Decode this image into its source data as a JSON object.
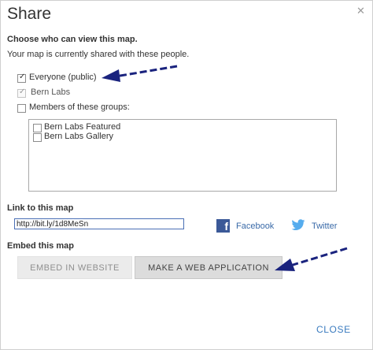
{
  "dialog": {
    "title": "Share",
    "close_link": "CLOSE"
  },
  "visibility": {
    "heading": "Choose who can view this map.",
    "description": "Your map is currently shared with these people.",
    "everyone_label": "Everyone (public)",
    "everyone_checked": true,
    "org_label": "Bern Labs",
    "org_checked": true,
    "groups_label": "Members of these groups:",
    "groups_checked": false,
    "groups": [
      {
        "label": "Bern Labs Featured",
        "checked": false
      },
      {
        "label": "Bern Labs Gallery",
        "checked": false
      }
    ]
  },
  "link": {
    "heading": "Link to this map",
    "url": "http://bit.ly/1d8MeSn",
    "facebook_label": "Facebook",
    "twitter_label": "Twitter",
    "facebook_color": "#3b5998",
    "twitter_color": "#55acee"
  },
  "embed": {
    "heading": "Embed this map",
    "embed_button": "EMBED IN WEBSITE",
    "webapp_button": "MAKE A WEB APPLICATION"
  },
  "annotations": {
    "arrow_color": "#1a237e"
  }
}
